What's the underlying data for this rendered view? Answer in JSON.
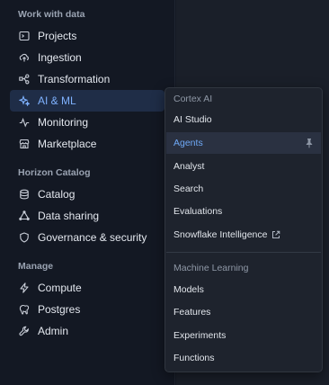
{
  "sidebar": {
    "sections": [
      {
        "title": "Work with data",
        "items": [
          {
            "label": "Projects",
            "icon": "terminal-icon",
            "active": false
          },
          {
            "label": "Ingestion",
            "icon": "cloud-upload-icon",
            "active": false
          },
          {
            "label": "Transformation",
            "icon": "transform-nodes-icon",
            "active": false
          },
          {
            "label": "AI & ML",
            "icon": "sparkle-icon",
            "active": true
          },
          {
            "label": "Monitoring",
            "icon": "activity-icon",
            "active": false
          },
          {
            "label": "Marketplace",
            "icon": "store-icon",
            "active": false
          }
        ]
      },
      {
        "title": "Horizon Catalog",
        "items": [
          {
            "label": "Catalog",
            "icon": "database-icon",
            "active": false
          },
          {
            "label": "Data sharing",
            "icon": "share-cloud-icon",
            "active": false
          },
          {
            "label": "Governance & security",
            "icon": "shield-icon",
            "active": false
          }
        ]
      },
      {
        "title": "Manage",
        "items": [
          {
            "label": "Compute",
            "icon": "lightning-icon",
            "active": false
          },
          {
            "label": "Postgres",
            "icon": "elephant-icon",
            "active": false
          },
          {
            "label": "Admin",
            "icon": "wrench-icon",
            "active": false
          }
        ]
      }
    ]
  },
  "dropdown": {
    "groups": [
      {
        "header": "Cortex AI",
        "items": [
          {
            "label": "AI Studio"
          },
          {
            "label": "Agents",
            "selected": true,
            "pinned": true
          },
          {
            "label": "Analyst"
          },
          {
            "label": "Search"
          },
          {
            "label": "Evaluations"
          },
          {
            "label": "Snowflake Intelligence",
            "external": true
          }
        ]
      },
      {
        "header": "Machine Learning",
        "items": [
          {
            "label": "Models"
          },
          {
            "label": "Features"
          },
          {
            "label": "Experiments"
          },
          {
            "label": "Functions"
          }
        ]
      }
    ]
  },
  "colors": {
    "accent": "#6fa9f7",
    "active_bg": "#1f2d47",
    "sidebar_bg": "#131823"
  }
}
